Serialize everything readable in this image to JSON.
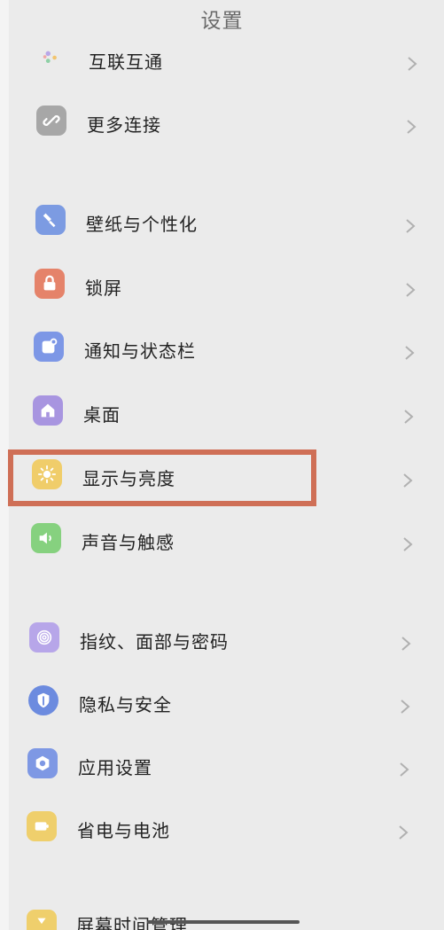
{
  "header": {
    "title": "设置"
  },
  "sections": [
    {
      "items": [
        {
          "id": "hulianhutong",
          "label": "互联互通",
          "icon": "dots-icon",
          "color": "#b9a7e8"
        },
        {
          "id": "more-connect",
          "label": "更多连接",
          "icon": "link-icon",
          "color": "#a7a7a7"
        }
      ]
    },
    {
      "items": [
        {
          "id": "wallpaper",
          "label": "壁纸与个性化",
          "icon": "brush-icon",
          "color": "#7c9be2"
        },
        {
          "id": "lockscreen",
          "label": "锁屏",
          "icon": "lock-icon",
          "color": "#e5836a"
        },
        {
          "id": "notification",
          "label": "通知与状态栏",
          "icon": "notification-icon",
          "color": "#7d97e6"
        },
        {
          "id": "desktop",
          "label": "桌面",
          "icon": "home-icon",
          "color": "#a895e0"
        },
        {
          "id": "display",
          "label": "显示与亮度",
          "icon": "sun-icon",
          "color": "#f0cd6a"
        },
        {
          "id": "sound",
          "label": "声音与触感",
          "icon": "speaker-icon",
          "color": "#86d17f"
        }
      ]
    },
    {
      "items": [
        {
          "id": "fingerprint",
          "label": "指纹、面部与密码",
          "icon": "fingerprint-icon",
          "color": "#b7a6e9"
        },
        {
          "id": "privacy",
          "label": "隐私与安全",
          "icon": "shield-icon",
          "color": "#6c8bdf"
        },
        {
          "id": "apps",
          "label": "应用设置",
          "icon": "hexagon-icon",
          "color": "#7e98e4"
        },
        {
          "id": "battery",
          "label": "省电与电池",
          "icon": "battery-icon",
          "color": "#efcf6c"
        }
      ]
    },
    {
      "items": [
        {
          "id": "screentime",
          "label": "屏幕时间管理",
          "icon": "hourglass-icon",
          "color": "#efcf6c"
        }
      ]
    }
  ],
  "highlight_item": "display"
}
